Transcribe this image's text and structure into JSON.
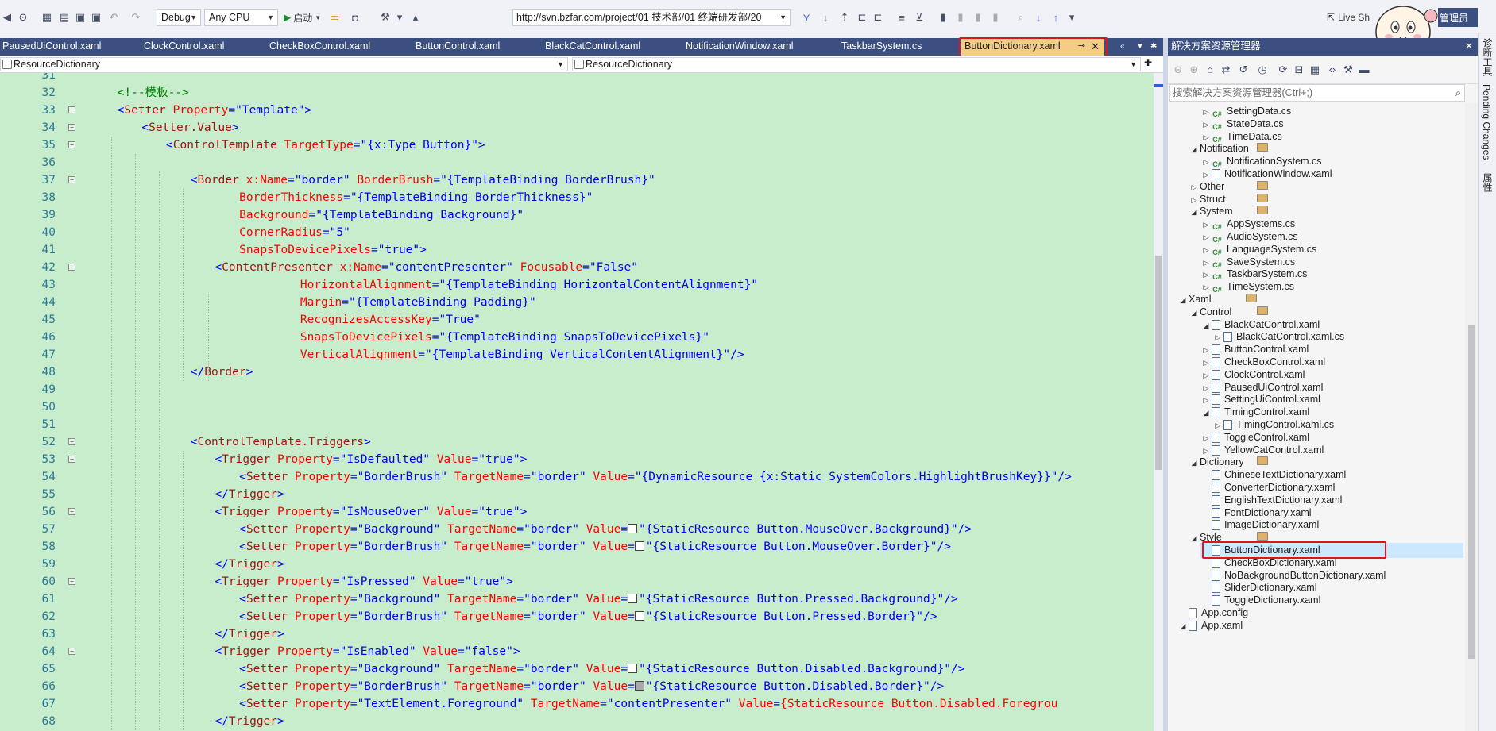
{
  "toolbar": {
    "config": "Debug",
    "platform": "Any CPU",
    "start": "启动",
    "url": "http://svn.bzfar.com/project/01 技术部/01 终端研发部/20   ",
    "live_share": "Live Sh",
    "admin": "管理员"
  },
  "tabs": [
    {
      "label": "PausedUiControl.xaml"
    },
    {
      "label": "ClockControl.xaml"
    },
    {
      "label": "CheckBoxControl.xaml"
    },
    {
      "label": "ButtonControl.xaml"
    },
    {
      "label": "BlackCatControl.xaml"
    },
    {
      "label": "NotificationWindow.xaml"
    },
    {
      "label": "TaskbarSystem.cs"
    },
    {
      "label": "ButtonDictionary.xaml"
    }
  ],
  "nav": {
    "left": "ResourceDictionary",
    "right": "ResourceDictionary"
  },
  "editor": {
    "lines": [
      {
        "n": "31",
        "t": ""
      },
      {
        "n": "32",
        "t": "<!--模板-->"
      },
      {
        "n": "33",
        "t": "<Setter Property=\"Template\">"
      },
      {
        "n": "34",
        "t": "<Setter.Value>"
      },
      {
        "n": "35",
        "t": "<ControlTemplate TargetType=\"{x:Type Button}\">"
      },
      {
        "n": "36",
        "t": ""
      },
      {
        "n": "37",
        "t": "<Border x:Name=\"border\" BorderBrush=\"{TemplateBinding BorderBrush}\""
      },
      {
        "n": "38",
        "t": "BorderThickness=\"{TemplateBinding BorderThickness}\""
      },
      {
        "n": "39",
        "t": "Background=\"{TemplateBinding Background}\""
      },
      {
        "n": "40",
        "t": "CornerRadius=\"5\""
      },
      {
        "n": "41",
        "t": "SnapsToDevicePixels=\"true\">"
      },
      {
        "n": "42",
        "t": "<ContentPresenter x:Name=\"contentPresenter\" Focusable=\"False\""
      },
      {
        "n": "43",
        "t": "HorizontalAlignment=\"{TemplateBinding HorizontalContentAlignment}\""
      },
      {
        "n": "44",
        "t": "Margin=\"{TemplateBinding Padding}\""
      },
      {
        "n": "45",
        "t": "RecognizesAccessKey=\"True\""
      },
      {
        "n": "46",
        "t": "SnapsToDevicePixels=\"{TemplateBinding SnapsToDevicePixels}\""
      },
      {
        "n": "47",
        "t": "VerticalAlignment=\"{TemplateBinding VerticalContentAlignment}\"/>"
      },
      {
        "n": "48",
        "t": "</Border>"
      },
      {
        "n": "49",
        "t": ""
      },
      {
        "n": "50",
        "t": ""
      },
      {
        "n": "51",
        "t": ""
      },
      {
        "n": "52",
        "t": "<ControlTemplate.Triggers>"
      },
      {
        "n": "53",
        "t": "<Trigger Property=\"IsDefaulted\" Value=\"true\">"
      },
      {
        "n": "54",
        "t": "<Setter Property=\"BorderBrush\" TargetName=\"border\" Value=\"{DynamicResource {x:Static SystemColors.HighlightBrushKey}}\"/>"
      },
      {
        "n": "55",
        "t": "</Trigger>"
      },
      {
        "n": "56",
        "t": "<Trigger Property=\"IsMouseOver\" Value=\"true\">"
      },
      {
        "n": "57",
        "t": "<Setter Property=\"Background\" TargetName=\"border\" Value=\"{StaticResource Button.MouseOver.Background}\"/>"
      },
      {
        "n": "58",
        "t": "<Setter Property=\"BorderBrush\" TargetName=\"border\" Value=\"{StaticResource Button.MouseOver.Border}\"/>"
      },
      {
        "n": "59",
        "t": "</Trigger>"
      },
      {
        "n": "60",
        "t": "<Trigger Property=\"IsPressed\" Value=\"true\">"
      },
      {
        "n": "61",
        "t": "<Setter Property=\"Background\" TargetName=\"border\" Value=\"{StaticResource Button.Pressed.Background}\"/>"
      },
      {
        "n": "62",
        "t": "<Setter Property=\"BorderBrush\" TargetName=\"border\" Value=\"{StaticResource Button.Pressed.Border}\"/>"
      },
      {
        "n": "63",
        "t": "</Trigger>"
      },
      {
        "n": "64",
        "t": "<Trigger Property=\"IsEnabled\" Value=\"false\">"
      },
      {
        "n": "65",
        "t": "<Setter Property=\"Background\" TargetName=\"border\" Value=\"{StaticResource Button.Disabled.Background}\"/>"
      },
      {
        "n": "66",
        "t": "<Setter Property=\"BorderBrush\" TargetName=\"border\" Value=\"{StaticResource Button.Disabled.Border}\"/>"
      },
      {
        "n": "67",
        "t": "<Setter Property=\"TextElement.Foreground\" TargetName=\"contentPresenter\" Value=\"{StaticResource Button.Disabled.Foregrou"
      },
      {
        "n": "68",
        "t": "</Trigger>"
      }
    ]
  },
  "solution_explorer": {
    "title": "解决方案资源管理器",
    "search_placeholder": "搜索解决方案资源管理器(Ctrl+;)",
    "items": [
      {
        "label": "SettingData.cs",
        "type": "cs",
        "level": 3,
        "exp": "right"
      },
      {
        "label": "StateData.cs",
        "type": "cs",
        "level": 3,
        "exp": "right"
      },
      {
        "label": "TimeData.cs",
        "type": "cs",
        "level": 3,
        "exp": "right"
      },
      {
        "label": "Notification",
        "type": "folder",
        "level": 2,
        "exp": "down"
      },
      {
        "label": "NotificationSystem.cs",
        "type": "cs",
        "level": 3,
        "exp": "right"
      },
      {
        "label": "NotificationWindow.xaml",
        "type": "xaml",
        "level": 3,
        "exp": "right"
      },
      {
        "label": "Other",
        "type": "folder",
        "level": 2,
        "exp": "right"
      },
      {
        "label": "Struct",
        "type": "folder",
        "level": 2,
        "exp": "right"
      },
      {
        "label": "System",
        "type": "folder",
        "level": 2,
        "exp": "down"
      },
      {
        "label": "AppSystems.cs",
        "type": "cs",
        "level": 3,
        "exp": "right"
      },
      {
        "label": "AudioSystem.cs",
        "type": "cs",
        "level": 3,
        "exp": "right"
      },
      {
        "label": "LanguageSystem.cs",
        "type": "cs",
        "level": 3,
        "exp": "right"
      },
      {
        "label": "SaveSystem.cs",
        "type": "cs",
        "level": 3,
        "exp": "right"
      },
      {
        "label": "TaskbarSystem.cs",
        "type": "cs",
        "level": 3,
        "exp": "right"
      },
      {
        "label": "TimeSystem.cs",
        "type": "cs",
        "level": 3,
        "exp": "right"
      },
      {
        "label": "Xaml",
        "type": "folder",
        "level": 1,
        "exp": "down"
      },
      {
        "label": "Control",
        "type": "folder",
        "level": 2,
        "exp": "down"
      },
      {
        "label": "BlackCatControl.xaml",
        "type": "xaml",
        "level": 3,
        "exp": "down"
      },
      {
        "label": "BlackCatControl.xaml.cs",
        "type": "xaml",
        "level": 4,
        "exp": "right"
      },
      {
        "label": "ButtonControl.xaml",
        "type": "xaml",
        "level": 3,
        "exp": "right"
      },
      {
        "label": "CheckBoxControl.xaml",
        "type": "xaml",
        "level": 3,
        "exp": "right"
      },
      {
        "label": "ClockControl.xaml",
        "type": "xaml",
        "level": 3,
        "exp": "right"
      },
      {
        "label": "PausedUiControl.xaml",
        "type": "xaml",
        "level": 3,
        "exp": "right"
      },
      {
        "label": "SettingUiControl.xaml",
        "type": "xaml",
        "level": 3,
        "exp": "right"
      },
      {
        "label": "TimingControl.xaml",
        "type": "xaml",
        "level": 3,
        "exp": "down"
      },
      {
        "label": "TimingControl.xaml.cs",
        "type": "xaml",
        "level": 4,
        "exp": "right"
      },
      {
        "label": "ToggleControl.xaml",
        "type": "xaml",
        "level": 3,
        "exp": "right"
      },
      {
        "label": "YellowCatControl.xaml",
        "type": "xaml",
        "level": 3,
        "exp": "right"
      },
      {
        "label": "Dictionary",
        "type": "folder",
        "level": 2,
        "exp": "down"
      },
      {
        "label": "ChineseTextDictionary.xaml",
        "type": "xaml",
        "level": 3,
        "exp": ""
      },
      {
        "label": "ConverterDictionary.xaml",
        "type": "xaml",
        "level": 3,
        "exp": ""
      },
      {
        "label": "EnglishTextDictionary.xaml",
        "type": "xaml",
        "level": 3,
        "exp": ""
      },
      {
        "label": "FontDictionary.xaml",
        "type": "xaml",
        "level": 3,
        "exp": ""
      },
      {
        "label": "ImageDictionary.xaml",
        "type": "xaml",
        "level": 3,
        "exp": ""
      },
      {
        "label": "Style",
        "type": "folder",
        "level": 2,
        "exp": "down"
      },
      {
        "label": "ButtonDictionary.xaml",
        "type": "xaml",
        "level": 3,
        "exp": "",
        "selected": true
      },
      {
        "label": "CheckBoxDictionary.xaml",
        "type": "xaml",
        "level": 3,
        "exp": ""
      },
      {
        "label": "NoBackgroundButtonDictionary.xaml",
        "type": "xaml",
        "level": 3,
        "exp": ""
      },
      {
        "label": "SliderDictionary.xaml",
        "type": "xaml",
        "level": 3,
        "exp": ""
      },
      {
        "label": "ToggleDictionary.xaml",
        "type": "xaml",
        "level": 3,
        "exp": ""
      },
      {
        "label": "App.config",
        "type": "config",
        "level": 1,
        "exp": ""
      },
      {
        "label": "App.xaml",
        "type": "xaml",
        "level": 1,
        "exp": "down"
      }
    ]
  },
  "right_panel": {
    "tabs": [
      "诊断工具",
      "Pending Changes",
      "属性"
    ]
  },
  "colors": {
    "tab_bar": "#3b4f81",
    "active_tab": "#f5cc84",
    "editor_bg": "#c7edcc",
    "highlight": "#e0141d",
    "tag": "#a31515",
    "attr": "#ff0000",
    "value": "#0000ff",
    "comment": "#008000"
  }
}
